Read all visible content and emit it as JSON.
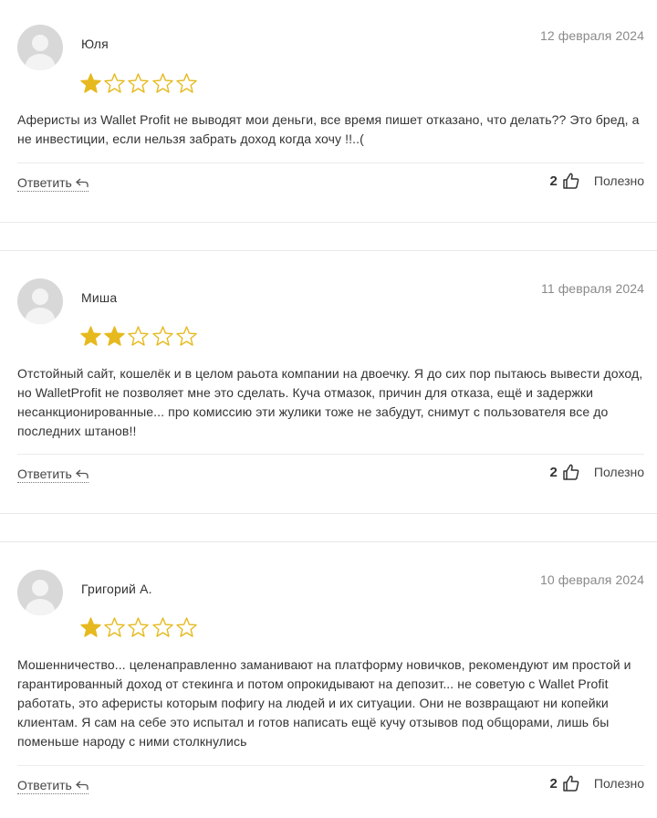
{
  "reviews": [
    {
      "name": "Юля",
      "date": "12 февраля 2024",
      "rating": 1,
      "text": "Аферисты из Wallet Profit не выводят мои деньги, все время пишет отказано, что делать?? Это бред, а не инвестиции, если нельзя забрать доход когда хочу !!..(",
      "reply_label": "Ответить",
      "likes": "2",
      "useful_label": "Полезно"
    },
    {
      "name": "Миша",
      "date": "11 февраля 2024",
      "rating": 2,
      "text": "Отстойный сайт, кошелёк и в целом раьота компании на двоечку. Я до сих пор пытаюсь вывести доход, но WalletProfit не позволяет мне это сделать. Куча отмазок, причин для отказа, ещё и задержки несанкционированные... про комиссию эти жулики тоже не забудут, снимут с пользователя все до последних штанов!!",
      "reply_label": "Ответить",
      "likes": "2",
      "useful_label": "Полезно"
    },
    {
      "name": "Григорий А.",
      "date": "10 февраля 2024",
      "rating": 1,
      "text": "Мошенничество... целенаправленно заманивают на платформу новичков, рекомендуют им простой и гарантированный доход от стекинга и потом опрокидывают на депозит... не советую с Wallet Profit работать, это аферисты которым пофигу на людей и их ситуации. Они не возвращают ни копейки клиентам. Я сам на себе это испытал и готов написать ещё кучу отзывов под общорами, лишь бы поменьше народу с ними столкнулись",
      "reply_label": "Ответить",
      "likes": "2",
      "useful_label": "Полезно"
    }
  ],
  "colors": {
    "star_filled": "#e6b91e",
    "star_outline": "#e6b91e",
    "date": "#8a8a8a",
    "text": "#333333"
  },
  "icons": {
    "avatar": "default-user-avatar",
    "reply": "reply-arrow-icon",
    "like": "thumbs-up-icon",
    "star": "star-icon"
  }
}
